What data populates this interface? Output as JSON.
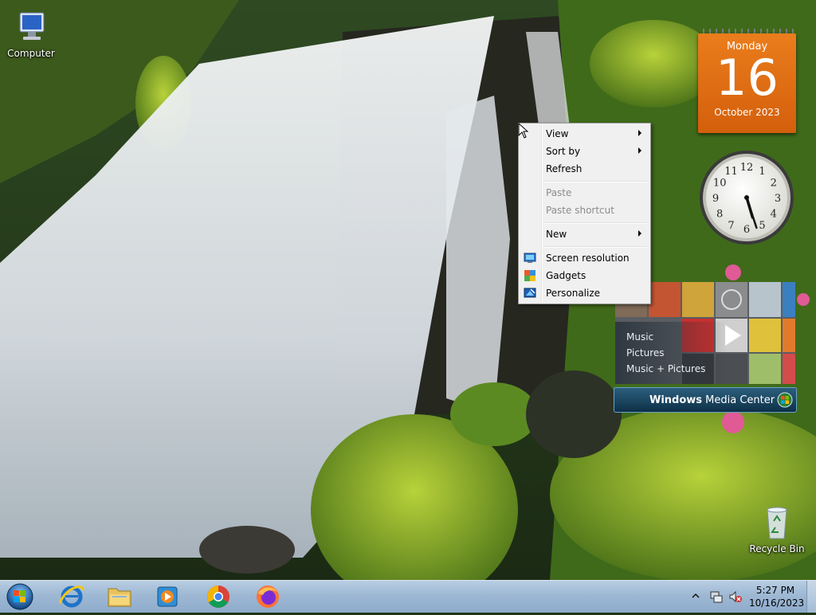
{
  "desktop": {
    "icons": [
      {
        "label": "Computer",
        "icon": "computer-icon"
      },
      {
        "label": "Recycle Bin",
        "icon": "recycle-bin-icon"
      }
    ]
  },
  "gadgets": {
    "calendar": {
      "weekday": "Monday",
      "day": "16",
      "month_year": "October 2023"
    },
    "clock": {
      "numerals": [
        "12",
        "1",
        "2",
        "3",
        "4",
        "5",
        "6",
        "7",
        "8",
        "9",
        "10",
        "11"
      ],
      "hour": 5,
      "minute": 27
    },
    "media_center": {
      "items": [
        "Music",
        "Pictures",
        "Music + Pictures"
      ],
      "brand_strong": "Windows",
      "brand_rest": " Media Center"
    }
  },
  "context_menu": {
    "items": [
      {
        "label": "View",
        "submenu": true,
        "enabled": true
      },
      {
        "label": "Sort by",
        "submenu": true,
        "enabled": true
      },
      {
        "label": "Refresh",
        "submenu": false,
        "enabled": true
      },
      {
        "label": "Paste",
        "submenu": false,
        "enabled": false
      },
      {
        "label": "Paste shortcut",
        "submenu": false,
        "enabled": false
      },
      {
        "label": "New",
        "submenu": true,
        "enabled": true
      },
      {
        "label": "Screen resolution",
        "submenu": false,
        "enabled": true,
        "icon": "screen-resolution-icon"
      },
      {
        "label": "Gadgets",
        "submenu": false,
        "enabled": true,
        "icon": "gadgets-icon"
      },
      {
        "label": "Personalize",
        "submenu": false,
        "enabled": true,
        "icon": "personalize-icon"
      }
    ]
  },
  "taskbar": {
    "pinned": [
      {
        "icon": "internet-explorer-icon"
      },
      {
        "icon": "file-explorer-icon"
      },
      {
        "icon": "media-player-icon"
      },
      {
        "icon": "chrome-icon"
      },
      {
        "icon": "firefox-icon"
      }
    ],
    "tray": {
      "time": "5:27 PM",
      "date": "10/16/2023"
    }
  },
  "colors": {
    "calendar_orange": "#e06a14",
    "taskbar_blue": "#9eb8d4",
    "menu_bg": "#f0f0f0"
  }
}
